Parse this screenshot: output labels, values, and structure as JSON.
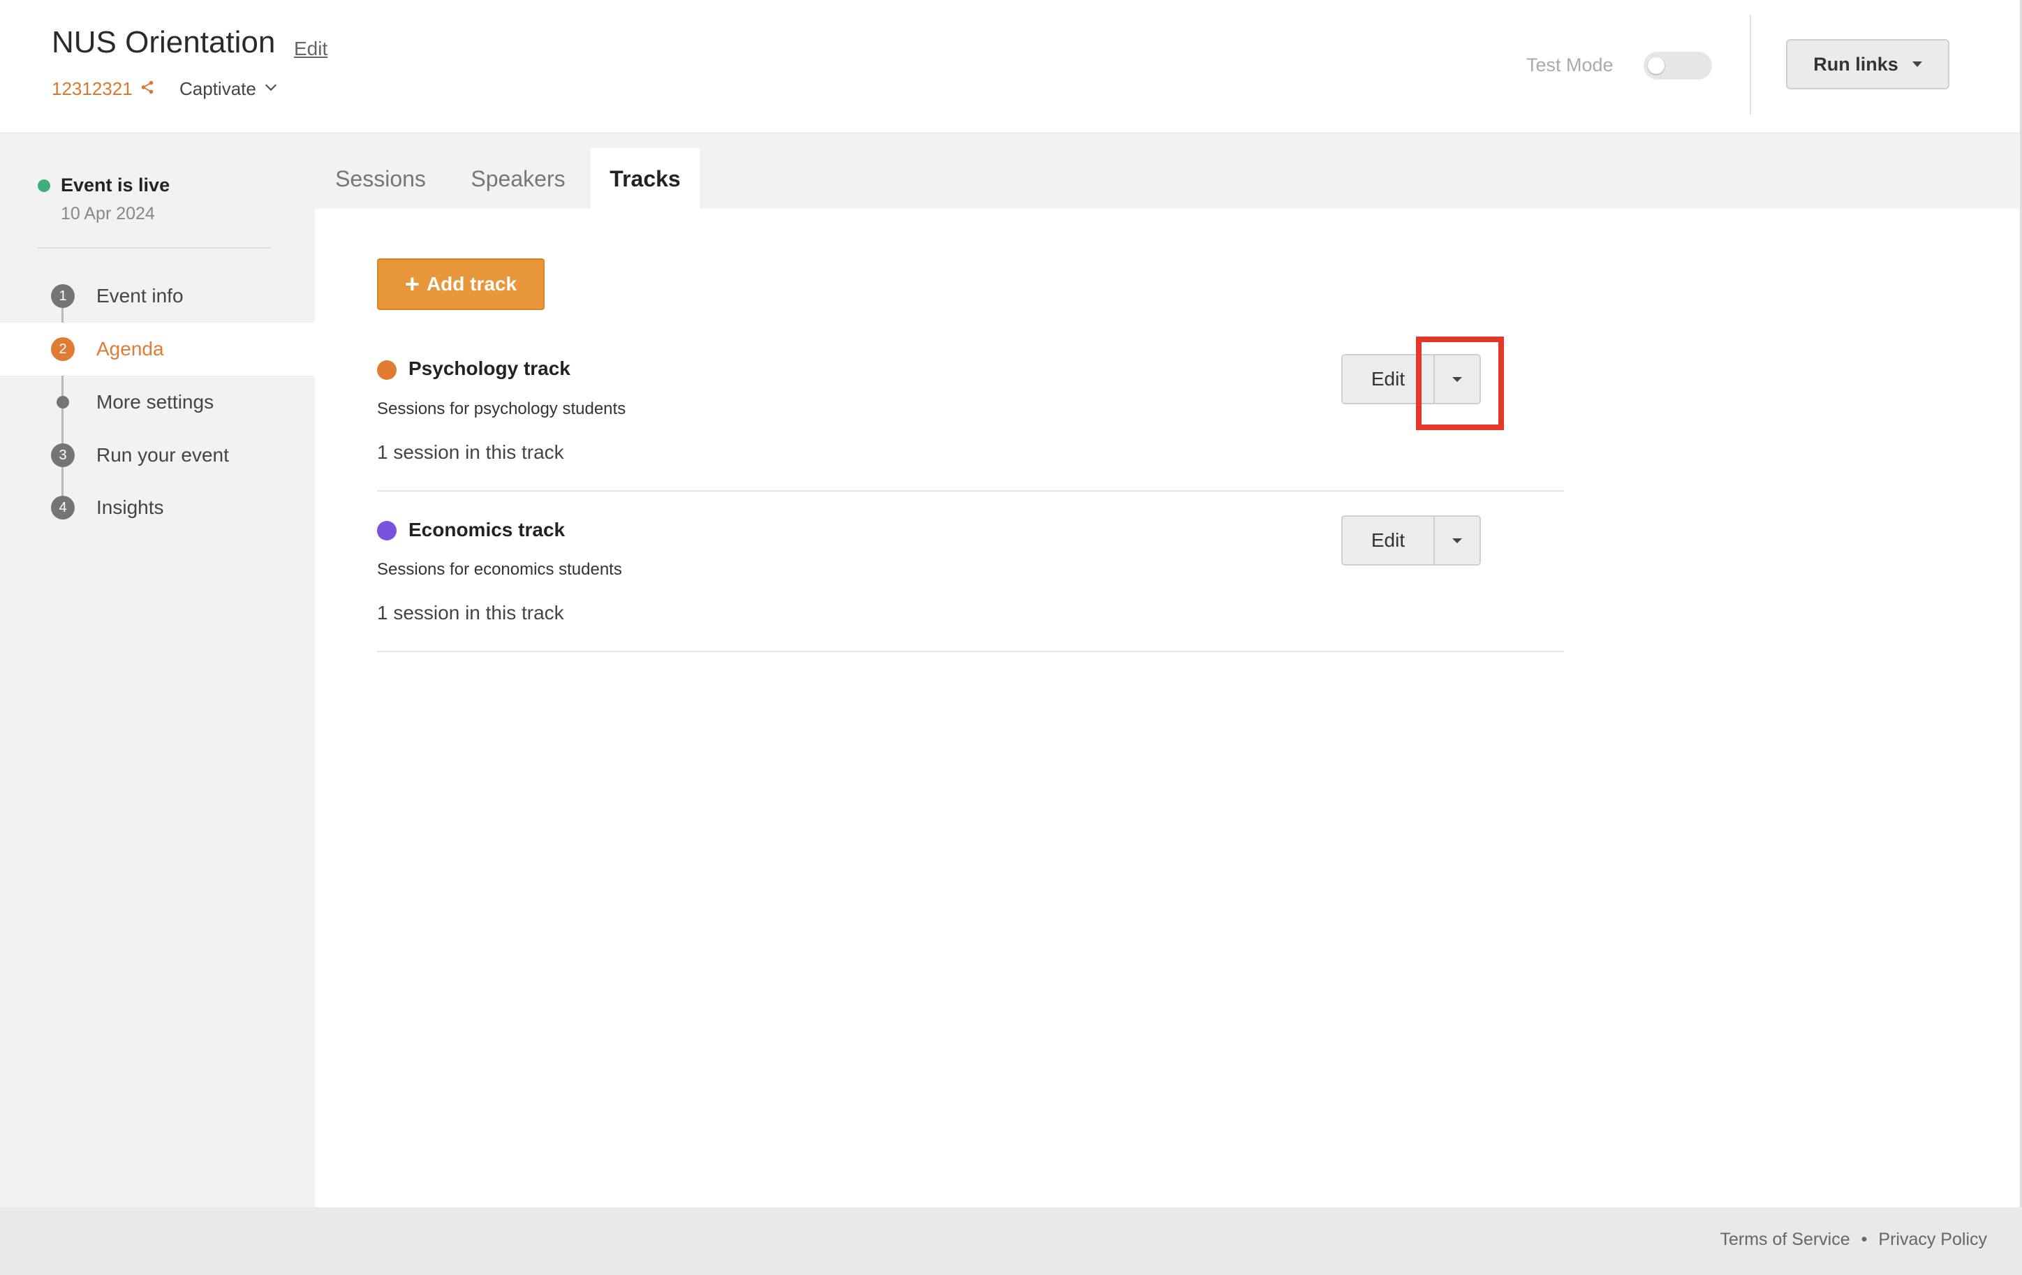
{
  "header": {
    "event_title": "NUS Orientation",
    "edit_label": "Edit",
    "event_id": "12312321",
    "org_name": "Captivate",
    "test_mode_label": "Test Mode",
    "test_mode_on": false,
    "run_links_label": "Run links"
  },
  "sidebar": {
    "status": "Event is live",
    "date": "10 Apr 2024",
    "status_color": "#3fae7d",
    "steps": [
      {
        "number": "1",
        "label": "Event info",
        "active": false
      },
      {
        "number": "2",
        "label": "Agenda",
        "active": true
      },
      {
        "number": "",
        "label": "More settings",
        "active": false
      },
      {
        "number": "3",
        "label": "Run your event",
        "active": false
      },
      {
        "number": "4",
        "label": "Insights",
        "active": false
      }
    ]
  },
  "tabs": [
    {
      "label": "Sessions",
      "active": false
    },
    {
      "label": "Speakers",
      "active": false
    },
    {
      "label": "Tracks",
      "active": true
    }
  ],
  "main": {
    "add_track_label": "Add track",
    "tracks": [
      {
        "name": "Psychology track",
        "description": "Sessions for psychology students",
        "count_text": "1 session in this track",
        "color": "#e07b33",
        "edit_label": "Edit"
      },
      {
        "name": "Economics track",
        "description": "Sessions for economics students",
        "count_text": "1 session in this track",
        "color": "#7b52e0",
        "edit_label": "Edit"
      }
    ]
  },
  "footer": {
    "terms": "Terms of Service",
    "separator": "•",
    "privacy": "Privacy Policy"
  },
  "colors": {
    "accent": "#e07b33",
    "add_button": "#e8963a",
    "highlight": "#e4372a"
  }
}
